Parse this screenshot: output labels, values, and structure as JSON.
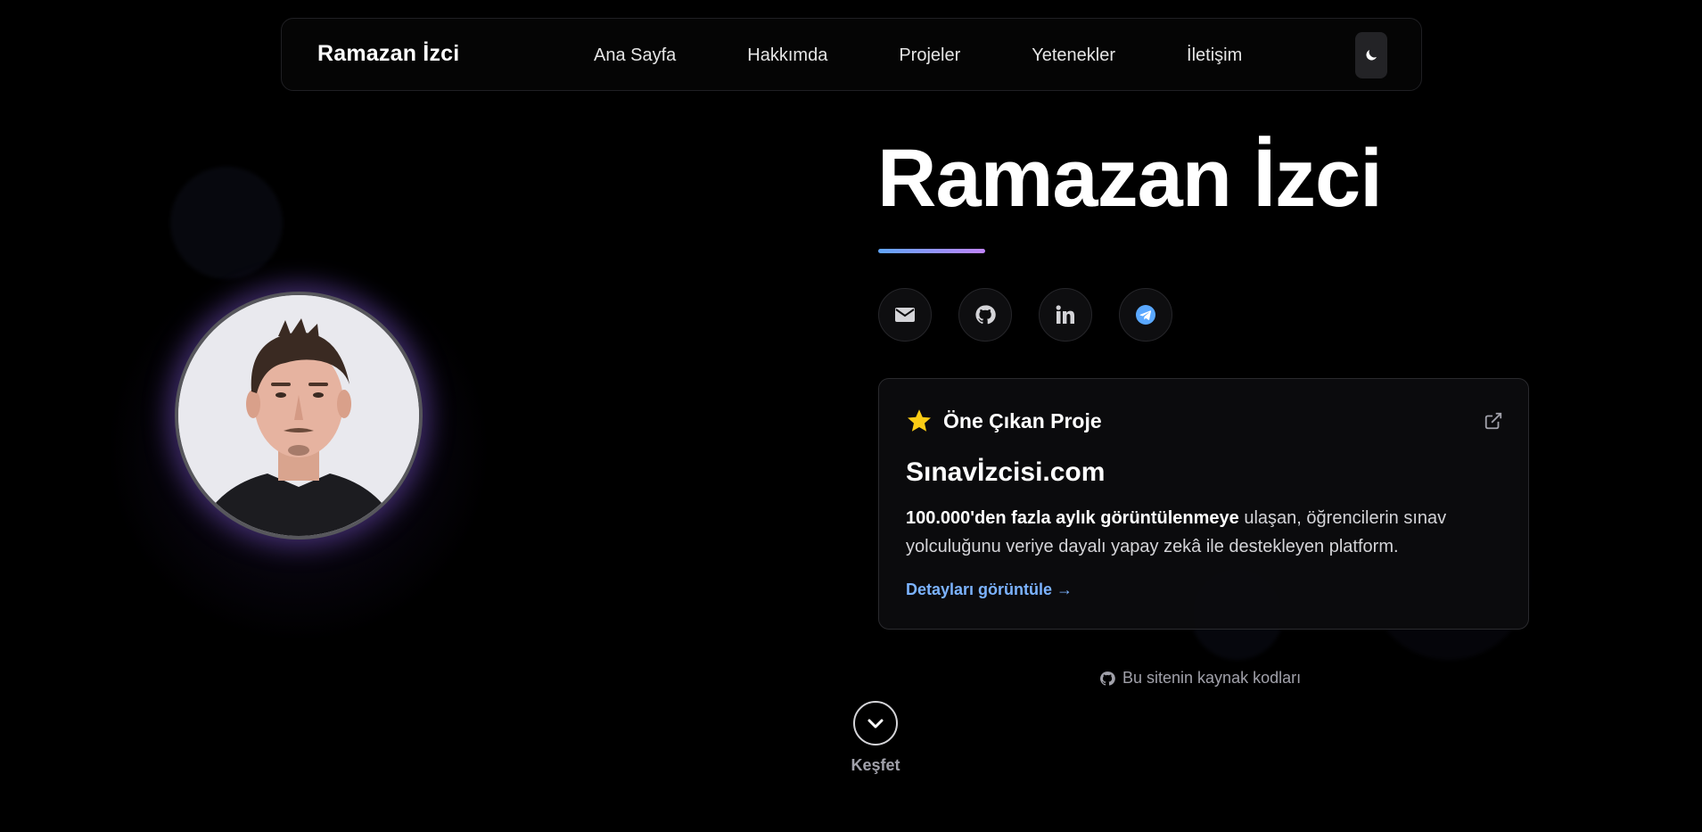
{
  "nav": {
    "brand": "Ramazan İzci",
    "links": [
      "Ana Sayfa",
      "Hakkımda",
      "Projeler",
      "Yetenekler",
      "İletişim"
    ],
    "theme_icon": "moon-icon"
  },
  "hero": {
    "name": "Ramazan İzci",
    "avatar_alt": "profile-photo",
    "socials": [
      "mail-icon",
      "github-icon",
      "linkedin-icon",
      "telegram-icon"
    ]
  },
  "featured": {
    "heading": "Öne Çıkan Proje",
    "title": "Sınavİzcisi.com",
    "desc_bold": "100.000'den fazla aylık görüntülenmeye",
    "desc_rest": " ulaşan, öğrencilerin sınav yolculuğunu veriye dayalı yapay zekâ ile destekleyen platform.",
    "link": "Detayları görüntüle →"
  },
  "footer": {
    "source": "Bu sitenin kaynak kodları",
    "explore": "Keşfet"
  },
  "colors": {
    "accent_blue": "#60a5fa",
    "accent_purple": "#c084fc",
    "link": "#7cb3ff",
    "star": "#facc15",
    "telegram": "#5aa8ff"
  }
}
